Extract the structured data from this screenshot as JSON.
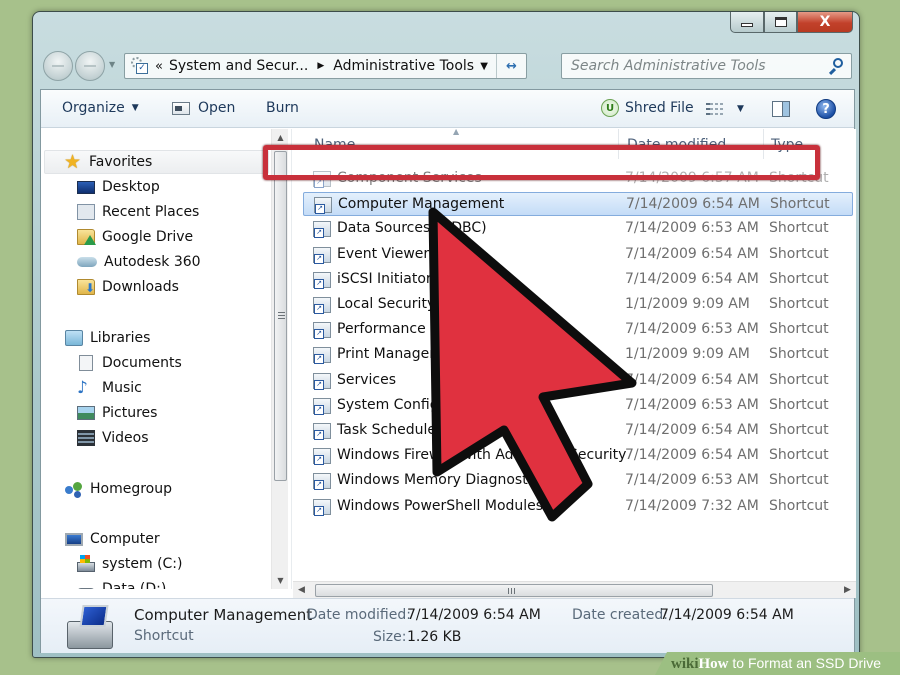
{
  "window": {
    "caption_buttons": {
      "minimize": "minimize",
      "maximize": "maximize",
      "close": "X"
    }
  },
  "address_bar": {
    "overflow": "«",
    "crumbs": [
      "System and Secur...",
      "Administrative Tools"
    ],
    "separator": "▶",
    "dropdown": "▼",
    "refresh": "↔"
  },
  "search": {
    "placeholder": "Search Administrative Tools"
  },
  "toolbar": {
    "organize": "Organize",
    "dropdown_arrow": "▼",
    "open": "Open",
    "burn": "Burn",
    "shred_badge": "U",
    "shred": "Shred File",
    "help": "?"
  },
  "navpane": {
    "favorites": "Favorites",
    "favorite_items": [
      "Desktop",
      "Recent Places",
      "Google Drive",
      "Autodesk 360",
      "Downloads"
    ],
    "libraries": "Libraries",
    "library_items": [
      "Documents",
      "Music",
      "Pictures",
      "Videos"
    ],
    "homegroup": "Homegroup",
    "computer": "Computer",
    "computer_items": [
      "system (C:)",
      "Data (D:)"
    ]
  },
  "columns": {
    "name": "Name",
    "date_modified": "Date modified",
    "type": "Type"
  },
  "files": [
    {
      "name": "Component Services",
      "date": "7/14/2009 6:57 AM",
      "type": "Shortcut"
    },
    {
      "name": "Computer Management",
      "date": "7/14/2009 6:54 AM",
      "type": "Shortcut",
      "selected": true
    },
    {
      "name": "Data Sources (ODBC)",
      "date": "7/14/2009 6:53 AM",
      "type": "Shortcut"
    },
    {
      "name": "Event Viewer",
      "date": "7/14/2009 6:54 AM",
      "type": "Shortcut"
    },
    {
      "name": "iSCSI Initiator",
      "date": "7/14/2009 6:54 AM",
      "type": "Shortcut"
    },
    {
      "name": "Local Security Policy",
      "date": "1/1/2009 9:09 AM",
      "type": "Shortcut"
    },
    {
      "name": "Performance Monitor",
      "date": "7/14/2009 6:53 AM",
      "type": "Shortcut"
    },
    {
      "name": "Print Management",
      "date": "1/1/2009 9:09 AM",
      "type": "Shortcut"
    },
    {
      "name": "Services",
      "date": "7/14/2009 6:54 AM",
      "type": "Shortcut"
    },
    {
      "name": "System Configuration",
      "date": "7/14/2009 6:53 AM",
      "type": "Shortcut"
    },
    {
      "name": "Task Scheduler",
      "date": "7/14/2009 6:54 AM",
      "type": "Shortcut"
    },
    {
      "name": "Windows Firewall with Advanced Security",
      "date": "7/14/2009 6:54 AM",
      "type": "Shortcut"
    },
    {
      "name": "Windows Memory Diagnostic",
      "date": "7/14/2009 6:53 AM",
      "type": "Shortcut"
    },
    {
      "name": "Windows PowerShell Modules",
      "date": "7/14/2009 7:32 AM",
      "type": "Shortcut"
    }
  ],
  "details": {
    "name": "Computer Management",
    "kind": "Shortcut",
    "date_modified_label": "Date modified:",
    "date_modified": "7/14/2009 6:54 AM",
    "size_label": "Size:",
    "size": "1.26 KB",
    "date_created_label": "Date created:",
    "date_created": "7/14/2009 6:54 AM"
  },
  "watermark": {
    "wiki": "wiki",
    "how": "How",
    "title": " to Format an SSD Drive"
  },
  "colors": {
    "highlight": "#c8303b",
    "arrow_fill": "#e0313f",
    "background": "#a7c18b"
  }
}
